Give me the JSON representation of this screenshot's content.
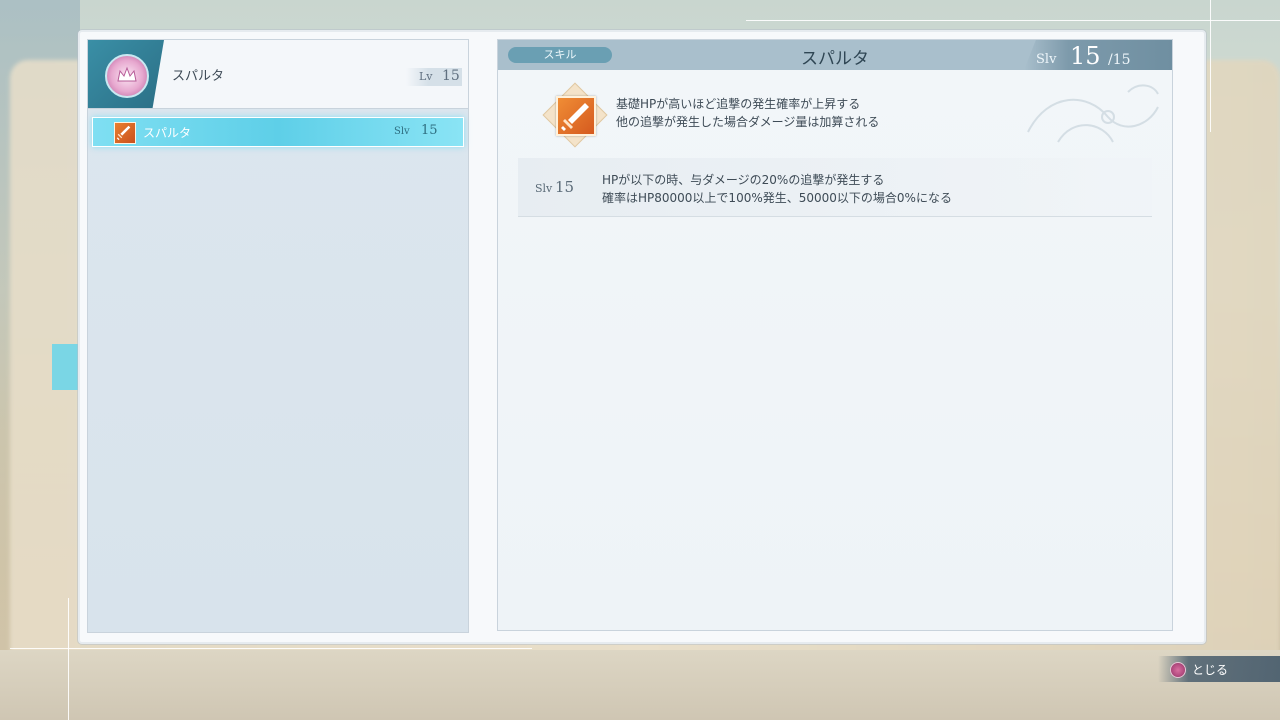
{
  "character": {
    "name": "スパルタ",
    "lv_label": "Lv",
    "lv_value": "15"
  },
  "skill_list": [
    {
      "name": "スパルタ",
      "slv_label": "Slv",
      "slv_value": "15",
      "icon": "sword-icon",
      "selected": true
    }
  ],
  "detail": {
    "tag": "スキル",
    "title": "スパルタ",
    "slv_label": "Slv",
    "slv_current": "15",
    "slv_max": "/15",
    "icon": "sword-icon",
    "description_lines": [
      "基礎HPが高いほど追撃の発生確率が上昇する",
      "他の追撃が発生した場合ダメージ量は加算される"
    ],
    "level_rows": [
      {
        "slv_label": "Slv",
        "slv_value": "15",
        "lines": [
          "HPが以下の時、与ダメージの20%の追撃が発生する",
          "確率はHP80000以上で100%発生、50000以下の場合0%になる"
        ]
      }
    ]
  },
  "controls": {
    "close_label": "とじる",
    "close_icon": "circle-button-icon"
  },
  "colors": {
    "header_bar": "#a9bfcc",
    "selected_row": "#5ecfe8",
    "tag_bg": "#6a9fb3",
    "skill_icon": "#e0701f"
  }
}
